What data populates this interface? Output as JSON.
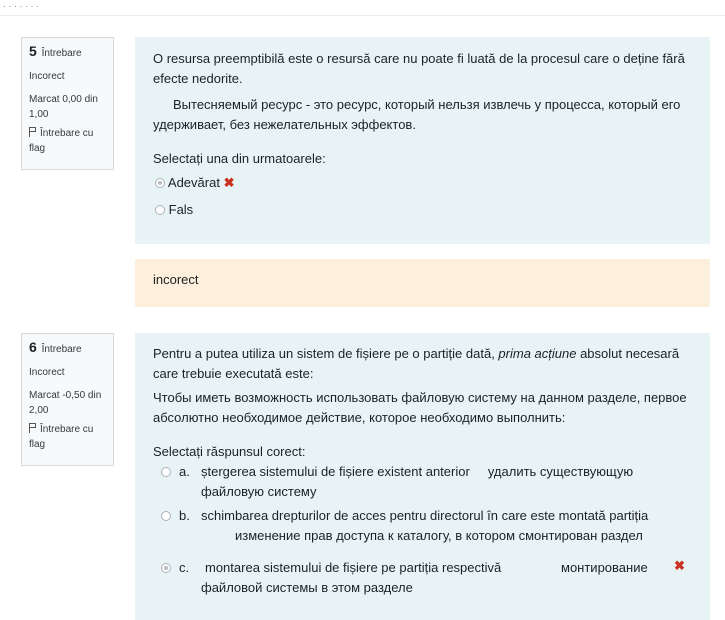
{
  "q5": {
    "number": "5",
    "label": "Întrebare",
    "status": "Incorect",
    "mark": "Marcat 0,00 din 1,00",
    "flag_label": "Întrebare cu flag",
    "text_ro": "O resursa preemptibilă este o resursă care nu poate fi luată de la procesul care o deține fără efecte nedorite.",
    "text_ru": "Вытесняемый ресурс  - это ресурс, который нельзя извлечь у процесса, который его удерживает, без нежелательных эффектов.",
    "prompt": "Selectați una din urmatoarele:",
    "options": [
      {
        "label": "Adevărat",
        "selected": true,
        "wrong": true
      },
      {
        "label": "Fals",
        "selected": false,
        "wrong": false
      }
    ],
    "feedback": "incorect"
  },
  "q6": {
    "number": "6",
    "label": "Întrebare",
    "status": "Incorect",
    "mark": "Marcat -0,50 din 2,00",
    "flag_label": "Întrebare cu flag",
    "text_ro_1": "Pentru a putea utiliza un sistem de fișiere pe o partiție dată, ",
    "text_ro_em": "prima acțiune",
    "text_ro_2": " absolut necesară care trebuie executată este:",
    "text_ru": "Чтобы иметь возможность использовать файловую систему на данном разделе, первое абсолютно необходимое действие, которое необходимо выполнить:",
    "prompt": "Selectați răspunsul corect:",
    "options": [
      {
        "letter": "a.",
        "ro": "ștergerea sistemului de fișiere existent anterior",
        "ru": "удалить существующую файловую систему",
        "selected": false
      },
      {
        "letter": "b.",
        "ro": "schimbarea drepturilor de acces pentru directorul în care este montată partiția",
        "ru": "изменение прав доступа к каталогу, в котором смонтирован раздел",
        "selected": false
      },
      {
        "letter": "c.",
        "ro": "montarea sistemului de fișiere pe partiția respectivă",
        "ru_1": "монтирование",
        "ru_2": "файловой системы в этом разделе",
        "selected": true,
        "wrong": true
      }
    ]
  },
  "icons": {
    "wrong": "✖"
  },
  "colors": {
    "question_bg": "#e7f3f5",
    "feedback_bg": "#fcefdc",
    "wrong": "#ca3120"
  }
}
